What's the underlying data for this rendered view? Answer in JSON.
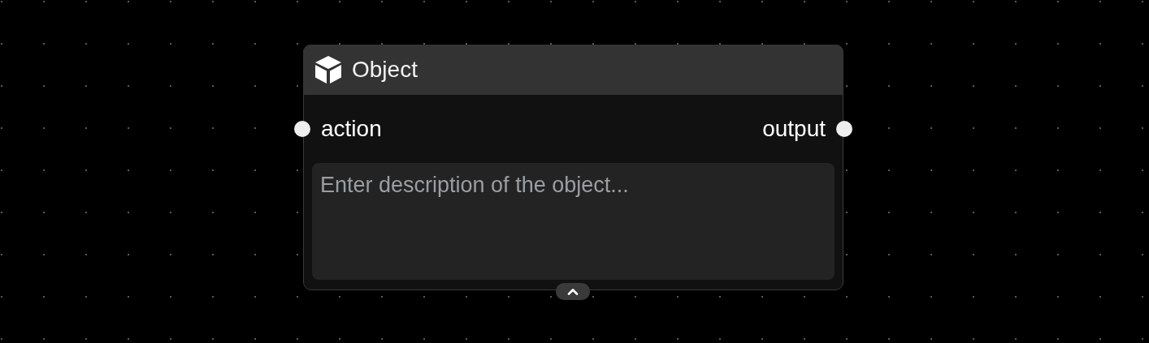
{
  "node": {
    "title": "Object",
    "inputs": [
      {
        "label": "action"
      }
    ],
    "outputs": [
      {
        "label": "output"
      }
    ],
    "description": {
      "placeholder": "Enter description of the object..."
    },
    "expanded": true
  }
}
